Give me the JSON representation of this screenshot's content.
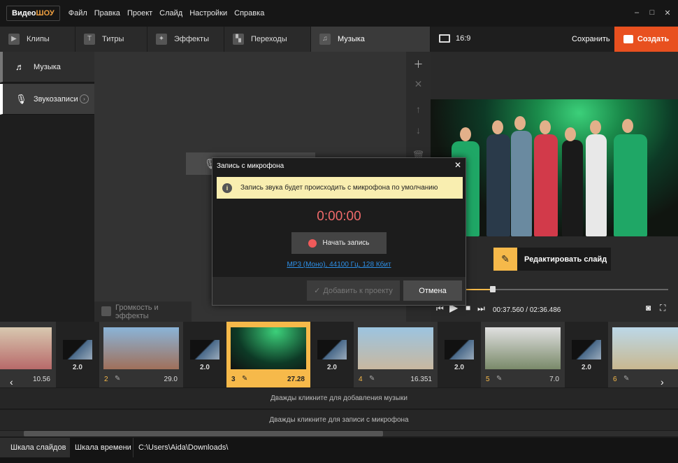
{
  "app": {
    "logo_main": "Видео",
    "logo_accent": "ШОУ",
    "menu": [
      "Файл",
      "Правка",
      "Проект",
      "Слайд",
      "Настройки",
      "Справка"
    ]
  },
  "tabs": [
    {
      "label": "Клипы",
      "icon": "play-icon"
    },
    {
      "label": "Титры",
      "icon": "text-icon"
    },
    {
      "label": "Эффекты",
      "icon": "magic-wand-icon"
    },
    {
      "label": "Переходы",
      "icon": "clapper-icon"
    },
    {
      "label": "Музыка",
      "icon": "music-note-icon"
    }
  ],
  "header": {
    "ratio": "16:9",
    "save": "Сохранить",
    "create": "Создать"
  },
  "sidebar": {
    "items": [
      {
        "label": "Музыка",
        "icon": "music-library-icon"
      },
      {
        "label": "Звукозаписи",
        "icon": "microphone-icon"
      }
    ]
  },
  "workspace": {
    "volume_effects": "Громкость и эффекты"
  },
  "preview": {
    "edit_slide": "Редактировать слайд",
    "time_current": "00:37.560",
    "time_total": "02:36.486",
    "position_fraction": 0.26
  },
  "timeline": {
    "slides": [
      {
        "num": "",
        "duration": "10.56"
      },
      {
        "num": "2",
        "duration": "29.0"
      },
      {
        "num": "3",
        "duration": "27.28"
      },
      {
        "num": "4",
        "duration": "16.351"
      },
      {
        "num": "5",
        "duration": "7.0"
      },
      {
        "num": "6",
        "duration": ""
      }
    ],
    "transitions": [
      "2.0",
      "2.0",
      "2.0",
      "2.0",
      "2.0"
    ],
    "music_hint": "Дважды кликните для добавления музыки",
    "mic_hint": "Дважды кликните для записи с микрофона"
  },
  "status": {
    "tab_slides": "Шкала слайдов",
    "tab_timeline": "Шкала времени",
    "path": "C:\\Users\\Aida\\Downloads\\"
  },
  "dialog": {
    "title": "Запись с микрофона",
    "info": "Запись звука будет происходить с микрофона по умолчанию",
    "timer": "0:00:00",
    "record": "Начать запись",
    "format": "MP3 (Моно), 44100 Гц, 128 Кбит",
    "add": "Добавить к проекту",
    "cancel": "Отмена"
  },
  "colors": {
    "accent": "#f6b94a",
    "create": "#e8501f",
    "timer": "#f06a6a",
    "link": "#2d8fe6"
  }
}
